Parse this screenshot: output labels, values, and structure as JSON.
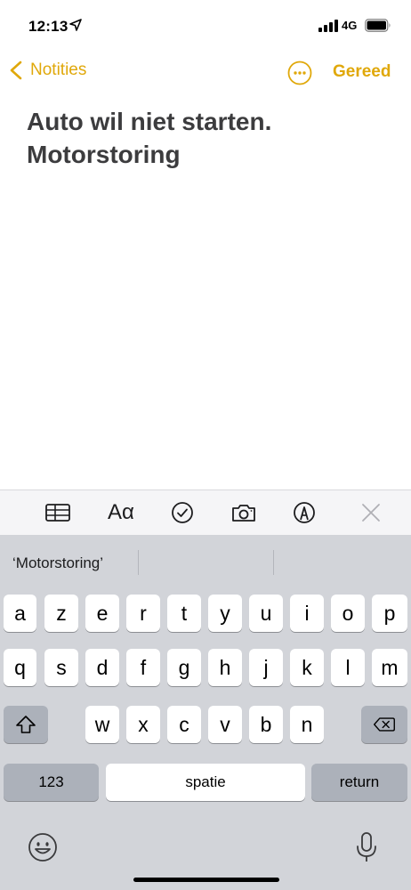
{
  "status_bar": {
    "time": "12:13",
    "network": "4G"
  },
  "nav": {
    "back_label": "Notities",
    "done_label": "Gereed"
  },
  "note": {
    "line1": "Auto wil niet starten.",
    "line2": "Motorstoring"
  },
  "toolbar": {
    "format_label": "Aα"
  },
  "keyboard": {
    "suggestion": "‘Motorstoring’",
    "row1": [
      "a",
      "z",
      "e",
      "r",
      "t",
      "y",
      "u",
      "i",
      "o",
      "p"
    ],
    "row2": [
      "q",
      "s",
      "d",
      "f",
      "g",
      "h",
      "j",
      "k",
      "l",
      "m"
    ],
    "row3": [
      "w",
      "x",
      "c",
      "v",
      "b",
      "n"
    ],
    "numbers_label": "123",
    "space_label": "spatie",
    "return_label": "return"
  },
  "colors": {
    "accent": "#e0a80a",
    "keyboard_bg": "#d2d4d9",
    "key_dark": "#acb1ba"
  }
}
